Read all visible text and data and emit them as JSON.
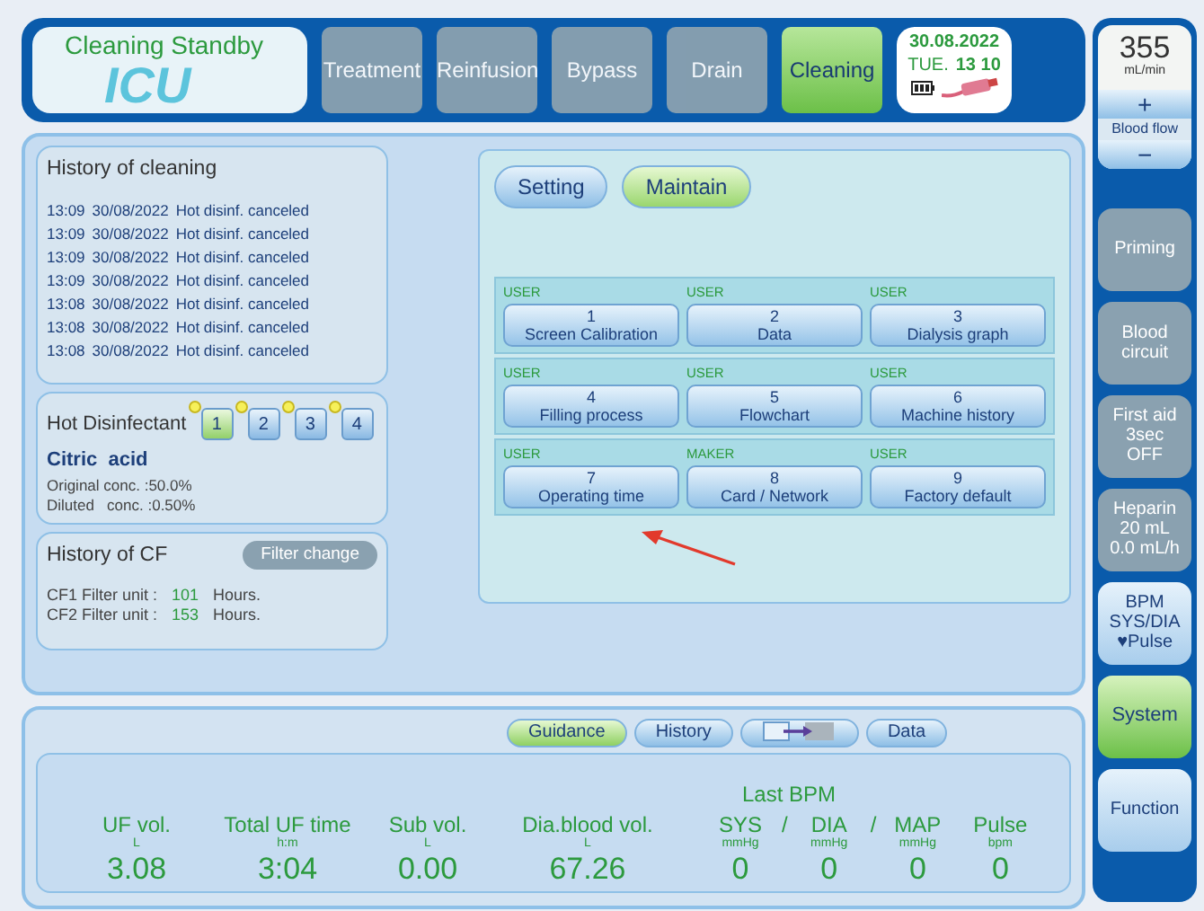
{
  "header": {
    "status": "Cleaning Standby",
    "watermark": "ICU",
    "tabs": [
      {
        "label": "Treatment",
        "selected": false,
        "disabled": true
      },
      {
        "label": "Reinfusion",
        "selected": false,
        "disabled": true
      },
      {
        "label": "Bypass",
        "selected": false,
        "disabled": true
      },
      {
        "label": "Drain",
        "selected": false,
        "disabled": true
      },
      {
        "label": "Cleaning",
        "selected": true,
        "disabled": false
      }
    ],
    "datetime": {
      "date": "30.08.2022",
      "day": "TUE.",
      "time": "13 10"
    }
  },
  "side": {
    "blood_flow": {
      "value": "355",
      "unit": "mL/min",
      "plus": "+",
      "label": "Blood flow",
      "minus": "−"
    },
    "buttons": [
      {
        "lines": [
          "Priming"
        ],
        "selected": false,
        "disabled": true
      },
      {
        "lines": [
          "Blood",
          "circuit"
        ],
        "selected": false,
        "disabled": true
      },
      {
        "lines": [
          "First aid",
          "3sec",
          "OFF"
        ],
        "selected": false,
        "disabled": true
      },
      {
        "lines": [
          "Heparin",
          "20 mL",
          "0.0 mL/h"
        ],
        "selected": false,
        "disabled": true
      },
      {
        "lines": [
          "BPM",
          "SYS/DIA",
          "♥Pulse"
        ],
        "selected": false,
        "disabled": false
      },
      {
        "lines": [
          "System"
        ],
        "selected": true,
        "disabled": false
      },
      {
        "lines": [
          "Function"
        ],
        "selected": false,
        "disabled": false
      }
    ]
  },
  "history": {
    "title": "History of cleaning",
    "entries": [
      {
        "time": "13:09",
        "date": "30/08/2022",
        "event": "Hot disinf. canceled"
      },
      {
        "time": "13:09",
        "date": "30/08/2022",
        "event": "Hot disinf. canceled"
      },
      {
        "time": "13:09",
        "date": "30/08/2022",
        "event": "Hot disinf. canceled"
      },
      {
        "time": "13:09",
        "date": "30/08/2022",
        "event": "Hot disinf. canceled"
      },
      {
        "time": "13:08",
        "date": "30/08/2022",
        "event": "Hot disinf. canceled"
      },
      {
        "time": "13:08",
        "date": "30/08/2022",
        "event": "Hot disinf. canceled"
      },
      {
        "time": "13:08",
        "date": "30/08/2022",
        "event": "Hot disinf. canceled"
      }
    ]
  },
  "disinfectant": {
    "label": "Hot Disinfectant",
    "options": [
      {
        "label": "1",
        "selected": true
      },
      {
        "label": "2",
        "selected": false
      },
      {
        "label": "3",
        "selected": false
      },
      {
        "label": "4",
        "selected": false
      }
    ],
    "chemical": "Citric  acid",
    "lines": [
      {
        "label": "Original conc. :",
        "value": "50.0%"
      },
      {
        "label": "Diluted   conc. :",
        "value": "0.50%"
      }
    ]
  },
  "cf": {
    "title": "History of CF",
    "button": {
      "label": "Filter change",
      "disabled": true
    },
    "rows": [
      {
        "label": "CF1 Filter unit :",
        "value": "101",
        "unit": "Hours."
      },
      {
        "label": "CF2 Filter unit :",
        "value": "153",
        "unit": "Hours."
      }
    ]
  },
  "maintain": {
    "modes": [
      {
        "label": "Setting",
        "selected": false
      },
      {
        "label": "Maintain",
        "selected": true
      }
    ],
    "groups": [
      [
        {
          "level": "USER",
          "number": "1",
          "label": "Screen Calibration"
        },
        {
          "level": "USER",
          "number": "2",
          "label": "Data"
        },
        {
          "level": "USER",
          "number": "3",
          "label": "Dialysis graph"
        }
      ],
      [
        {
          "level": "USER",
          "number": "4",
          "label": "Filling process"
        },
        {
          "level": "USER",
          "number": "5",
          "label": "Flowchart"
        },
        {
          "level": "USER",
          "number": "6",
          "label": "Machine history"
        }
      ],
      [
        {
          "level": "USER",
          "number": "7",
          "label": "Operating time"
        },
        {
          "level": "MAKER",
          "number": "8",
          "label": "Card / Network"
        },
        {
          "level": "USER",
          "number": "9",
          "label": "Factory default"
        }
      ]
    ]
  },
  "bottom": {
    "tabs": [
      {
        "kind": "text",
        "label": "Guidance",
        "selected": true
      },
      {
        "kind": "text",
        "label": "History",
        "selected": false
      },
      {
        "kind": "icon",
        "selected": false
      },
      {
        "kind": "text",
        "label": "Data",
        "selected": false
      }
    ],
    "metrics": [
      {
        "label": "UF vol.",
        "unit": "L",
        "value": "3.08"
      },
      {
        "label": "Total UF time",
        "unit": "h:m",
        "value": "3:04"
      },
      {
        "label": "Sub vol.",
        "unit": "L",
        "value": "0.00"
      },
      {
        "label": "Dia.blood vol.",
        "unit": "L",
        "value": "67.26"
      }
    ],
    "bpm_title": "Last BPM",
    "separator": "/",
    "bpm": [
      {
        "label": "SYS",
        "unit": "mmHg",
        "value": "0"
      },
      {
        "label": "DIA",
        "unit": "mmHg",
        "value": "0"
      },
      {
        "label": "MAP",
        "unit": "mmHg",
        "value": "0"
      },
      {
        "label": "Pulse",
        "unit": "bpm",
        "value": "0"
      }
    ]
  }
}
